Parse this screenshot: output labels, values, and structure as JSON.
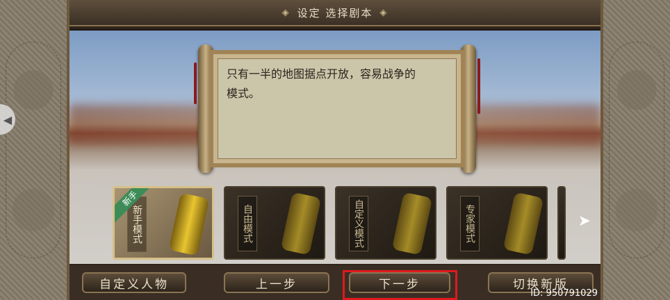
{
  "header": {
    "ornament_left": "◈",
    "title": "设定 选择剧本",
    "ornament_right": "◈"
  },
  "edge_handle": {
    "glyph": "◀"
  },
  "description": {
    "text_line1": "只有一半的地图据点开放，容易战争的",
    "text_line2": "模式。"
  },
  "cards": [
    {
      "label": "新手模式",
      "badge": "新手",
      "selected": true
    },
    {
      "label": "自由模式",
      "selected": false
    },
    {
      "label": "自定义模式",
      "selected": false
    },
    {
      "label": "专家模式",
      "selected": false
    }
  ],
  "next_arrow": "➤",
  "buttons": {
    "custom_character": "自定义人物",
    "prev_step": "上一步",
    "next_step": "下一步",
    "switch_version": "切换新版"
  },
  "watermark": "ID: 950791029",
  "colors": {
    "highlight": "#e0191e",
    "selected_border": "#d6c08a",
    "badge_green": "#3d8c57"
  }
}
